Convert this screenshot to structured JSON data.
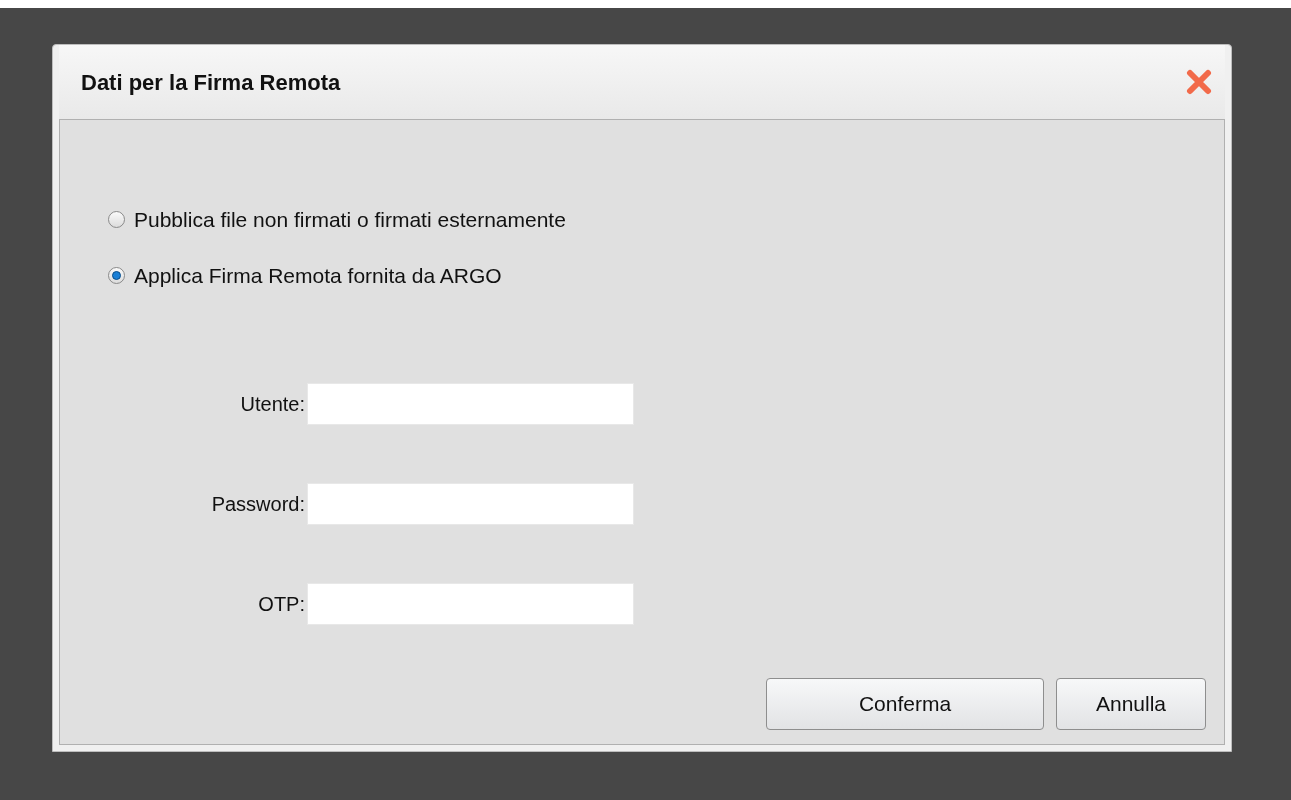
{
  "dialog": {
    "title": "Dati per la Firma Remota"
  },
  "options": [
    {
      "label": "Pubblica file non firmati o firmati esternamente",
      "selected": false
    },
    {
      "label": "Applica Firma Remota fornita da ARGO",
      "selected": true
    }
  ],
  "fields": [
    {
      "label": "Utente:"
    },
    {
      "label": "Password:"
    },
    {
      "label": "OTP:"
    }
  ],
  "buttons": [
    "Conferma",
    "Annulla"
  ]
}
